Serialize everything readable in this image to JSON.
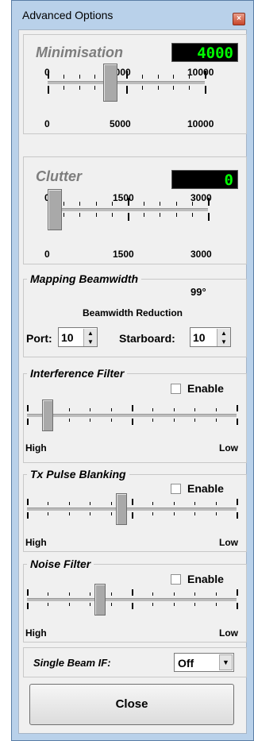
{
  "window": {
    "title": "Advanced Options",
    "close_glyph": "×"
  },
  "minimisation": {
    "title": "Minimisation",
    "value": "4000",
    "scale_top": [
      "0",
      "5000",
      "10000"
    ],
    "scale_bottom": [
      "0",
      "5000",
      "10000"
    ],
    "slider_fraction": 0.4
  },
  "clutter": {
    "title": "Clutter",
    "value": "0",
    "scale_top": [
      "0",
      "1500",
      "3000"
    ],
    "scale_bottom": [
      "0",
      "1500",
      "3000"
    ],
    "slider_fraction": 0.0
  },
  "mapping": {
    "title": "Mapping Beamwidth",
    "angle": "99°",
    "reduction_label": "Beamwidth Reduction",
    "port_label": "Port:",
    "port_value": "10",
    "starboard_label": "Starboard:",
    "starboard_value": "10"
  },
  "interference": {
    "title": "Interference Filter",
    "enable_label": "Enable",
    "enabled": false,
    "high": "High",
    "low": "Low",
    "slider_fraction": 0.1
  },
  "tx_pulse": {
    "title": "Tx Pulse Blanking",
    "enable_label": "Enable",
    "enabled": false,
    "high": "High",
    "low": "Low",
    "slider_fraction": 0.45
  },
  "noise": {
    "title": "Noise Filter",
    "enable_label": "Enable",
    "enabled": false,
    "high": "High",
    "low": "Low",
    "slider_fraction": 0.35
  },
  "single_beam": {
    "label": "Single Beam IF:",
    "value": "Off"
  },
  "close_button": {
    "label": "Close"
  },
  "colors": {
    "lcd_text": "#00ff00",
    "lcd_bg": "#000000",
    "frame": "#b9d1ea",
    "client_bg": "#f0f0f0"
  }
}
